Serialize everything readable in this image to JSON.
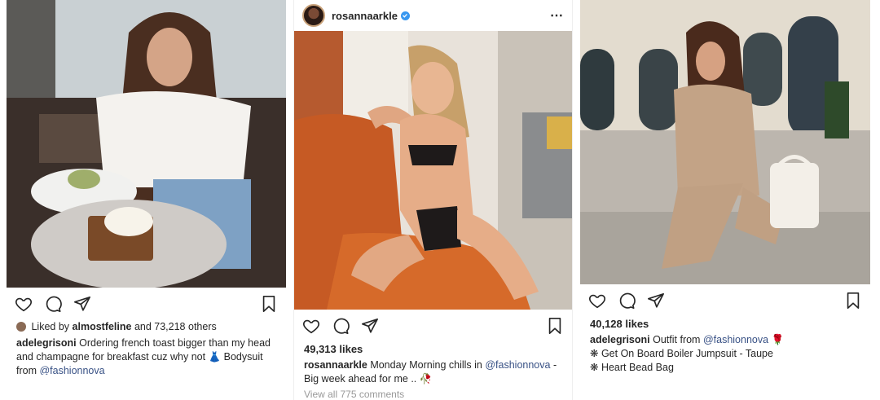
{
  "posts": [
    {
      "likes_prefix": "Liked by",
      "liked_by_user": "almostfeline",
      "likes_suffix": "and 73,218 others",
      "caption_user": "adelegrisoni",
      "caption_text": "Ordering french toast bigger than my head and champagne for breakfast cuz why not",
      "caption_emoji": "👗",
      "caption_text2": "Bodysuit from",
      "caption_mention": "@fashionnova"
    },
    {
      "header_handle": "rosannaarkle",
      "more_icon": "⋯",
      "likes": "49,313 likes",
      "caption_user": "rosannaarkle",
      "caption_text": "Monday Morning chills in",
      "caption_mention": "@fashionnova",
      "caption_text2": "- Big week ahead for me ..",
      "caption_emoji": "🥀",
      "comments": "View all 775 comments"
    },
    {
      "likes": "40,128 likes",
      "caption_user": "adelegrisoni",
      "caption_text": "Outfit from",
      "caption_mention": "@fashionnova",
      "caption_emoji": "🌹",
      "line2": "❋ Get On Board Boiler Jumpsuit - Taupe",
      "line3": "❋ Heart Bead Bag"
    }
  ],
  "colors": {
    "text": "#262626",
    "mention": "#385185",
    "muted": "#999999",
    "verified": "#3897f0"
  },
  "icons": [
    "heart-icon",
    "comment-icon",
    "share-icon",
    "bookmark-icon",
    "verified-icon",
    "more-icon"
  ]
}
